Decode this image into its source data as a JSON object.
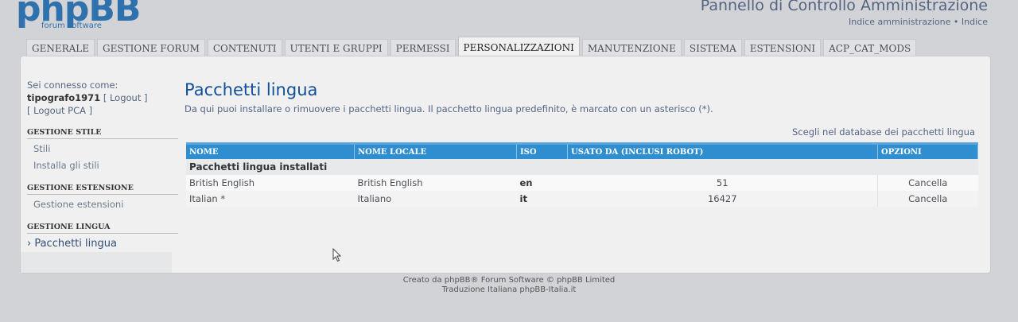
{
  "header": {
    "logo_text": "phpBB",
    "logo_sub": "forum  software",
    "title": "Pannello di Controllo Amministrazione",
    "links": [
      "Indice amministrazione",
      "Indice"
    ],
    "link_separator": "•"
  },
  "tabs": [
    {
      "label": "GENERALE",
      "active": false
    },
    {
      "label": "GESTIONE FORUM",
      "active": false
    },
    {
      "label": "CONTENUTI",
      "active": false
    },
    {
      "label": "UTENTI E GRUPPI",
      "active": false
    },
    {
      "label": "PERMESSI",
      "active": false
    },
    {
      "label": "PERSONALIZZAZIONI",
      "active": true
    },
    {
      "label": "MANUTENZIONE",
      "active": false
    },
    {
      "label": "SISTEMA",
      "active": false
    },
    {
      "label": "ESTENSIONI",
      "active": false
    },
    {
      "label": "ACP_CAT_MODS",
      "active": false
    }
  ],
  "sidebar": {
    "connected_label": "Sei connesso come:",
    "username": "tipografo1971",
    "logout": "[ Logout ]",
    "logout_pca": "[ Logout PCA ]",
    "sections": [
      {
        "heading": "GESTIONE STILE",
        "items": [
          {
            "label": "Stili",
            "active": false
          },
          {
            "label": "Installa gli stili",
            "active": false
          }
        ]
      },
      {
        "heading": "GESTIONE ESTENSIONE",
        "items": [
          {
            "label": "Gestione estensioni",
            "active": false
          }
        ]
      },
      {
        "heading": "GESTIONE LINGUA",
        "items": [
          {
            "label": "› Pacchetti lingua",
            "active": true
          }
        ]
      }
    ]
  },
  "main": {
    "title": "Pacchetti lingua",
    "description": "Da qui puoi installare o rimuovere i pacchetti lingua. Il pacchetto lingua predefinito, è marcato con un asterisco (*).",
    "db_link": "Scegli nel database dei pacchetti lingua",
    "table": {
      "columns": [
        "NOME",
        "NOME LOCALE",
        "ISO",
        "USATO DA (INCLUSI ROBOT)",
        "OPZIONI"
      ],
      "group_label": "Pacchetti lingua installati",
      "rows": [
        {
          "name": "British English",
          "local_name": "British English",
          "iso": "en",
          "used_by": "51",
          "option": "Cancella"
        },
        {
          "name": "Italian *",
          "local_name": "Italiano",
          "iso": "it",
          "used_by": "16427",
          "option": "Cancella"
        }
      ]
    }
  },
  "footer": {
    "line1": "Creato da phpBB® Forum Software © phpBB Limited",
    "line2": "Traduzione Italiana phpBB-Italia.it"
  },
  "colors": {
    "brand": "#2e71ad",
    "table_header": "#2e8ecf",
    "title": "#115098"
  }
}
